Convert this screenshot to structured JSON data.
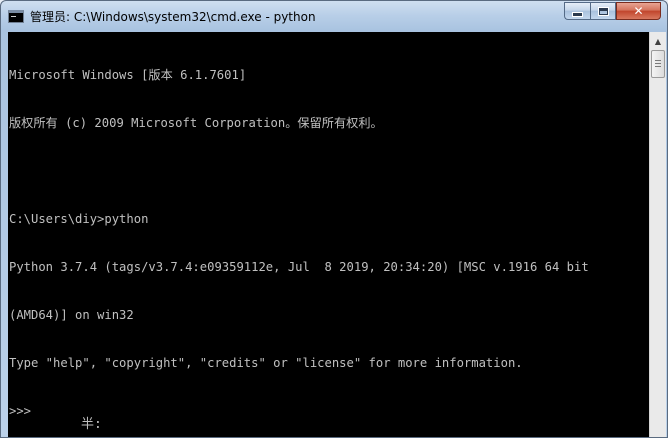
{
  "window": {
    "title": "管理员: C:\\Windows\\system32\\cmd.exe - python",
    "icon": "cmd-icon",
    "buttons": {
      "minimize": "minimize-icon",
      "maximize": "maximize-icon",
      "close": "✕"
    }
  },
  "console": {
    "lines": [
      "Microsoft Windows [版本 6.1.7601]",
      "版权所有 (c) 2009 Microsoft Corporation。保留所有权利。",
      "",
      "C:\\Users\\diy>python",
      "Python 3.7.4 (tags/v3.7.4:e09359112e, Jul  8 2019, 20:34:20) [MSC v.1916 64 bit",
      "(AMD64)] on win32",
      "Type \"help\", \"copyright\", \"credits\" or \"license\" for more information.",
      ">>>"
    ],
    "ime_status": "半:"
  },
  "colors": {
    "console_bg": "#000000",
    "console_fg": "#c0c0c0"
  }
}
